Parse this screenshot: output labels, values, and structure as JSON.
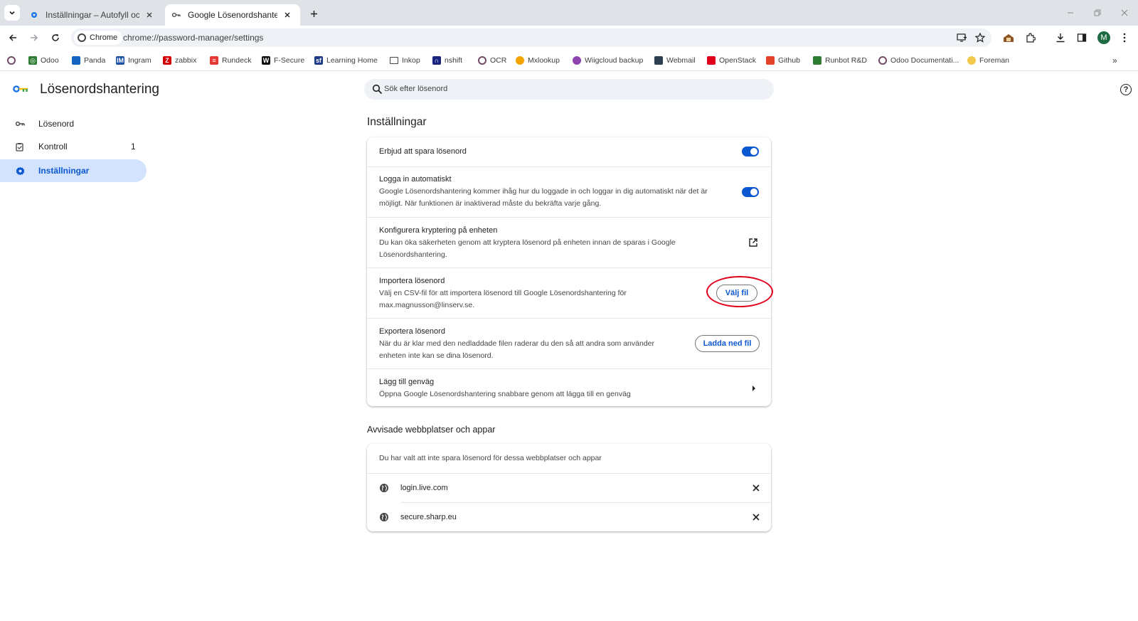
{
  "browser": {
    "tabs": [
      {
        "title": "Inställningar – Autofyll och lösenord",
        "icon": "gear-icon"
      },
      {
        "title": "Google Lösenordshantering",
        "icon": "key-icon"
      }
    ],
    "omnibox": {
      "chip_label": "Chrome",
      "url": "chrome://password-manager/settings"
    },
    "avatar_initial": "M"
  },
  "bookmarks": [
    {
      "label": "",
      "icon": "odoo-circle-icon",
      "color": "#714b67"
    },
    {
      "label": "Odoo",
      "icon": "odoo-icon",
      "color": "#2e7d32"
    },
    {
      "label": "Panda",
      "icon": "panda-icon",
      "color": "#1565c0"
    },
    {
      "label": "Ingram",
      "icon": "ingram-icon",
      "color": "#1a4fa3"
    },
    {
      "label": "zabbix",
      "icon": "zabbix-icon",
      "color": "#d40000"
    },
    {
      "label": "Rundeck",
      "icon": "rundeck-icon",
      "color": "#e53935"
    },
    {
      "label": "F-Secure",
      "icon": "fsecure-icon",
      "color": "#111111"
    },
    {
      "label": "Learning Home",
      "icon": "salesforce-icon",
      "color": "#1e3a8a"
    },
    {
      "label": "Inkop",
      "icon": "folder-icon",
      "color": "#444444"
    },
    {
      "label": "nshift",
      "icon": "nshift-icon",
      "color": "#1a237e"
    },
    {
      "label": "OCR",
      "icon": "ocr-icon",
      "color": "#714b67"
    },
    {
      "label": "Mxlookup",
      "icon": "mxlookup-icon",
      "color": "#f4a300"
    },
    {
      "label": "Wiigcloud backup",
      "icon": "wiigcloud-icon",
      "color": "#8e44ad"
    },
    {
      "label": "Webmail",
      "icon": "webmail-icon",
      "color": "#2c3e50"
    },
    {
      "label": "OpenStack",
      "icon": "openstack-icon",
      "color": "#e0001b"
    },
    {
      "label": "Github",
      "icon": "gitlab-icon",
      "color": "#e24329"
    },
    {
      "label": "Runbot R&D",
      "icon": "runbot-icon",
      "color": "#2e7d32"
    },
    {
      "label": "Odoo Documentati...",
      "icon": "odoo-circle-icon",
      "color": "#714b67"
    },
    {
      "label": "Foreman",
      "icon": "foreman-icon",
      "color": "#f2c94c"
    }
  ],
  "app": {
    "title": "Lösenordshantering"
  },
  "sidebar": {
    "items": [
      {
        "label": "Lösenord",
        "icon": "key-icon"
      },
      {
        "label": "Kontroll",
        "icon": "checkup-icon",
        "count": "1"
      },
      {
        "label": "Inställningar",
        "icon": "gear-icon",
        "active": true
      }
    ]
  },
  "search": {
    "placeholder": "Sök efter lösenord"
  },
  "settings": {
    "section_title": "Inställningar",
    "offer_save": {
      "title": "Erbjud att spara lösenord",
      "enabled": true
    },
    "auto_signin": {
      "title": "Logga in automatiskt",
      "description": "Google Lösenordshantering kommer ihåg hur du loggade in och loggar in dig automatiskt när det är möjligt. När funktionen är inaktiverad måste du bekräfta varje gång.",
      "enabled": true
    },
    "encryption": {
      "title": "Konfigurera kryptering på enheten",
      "description": "Du kan öka säkerheten genom att kryptera lösenord på enheten innan de sparas i Google Lösenordshantering."
    },
    "import": {
      "title": "Importera lösenord",
      "description": "Välj en CSV-fil för att importera lösenord till Google Lösenordshantering för max.magnusson@linserv.se.",
      "button": "Välj fil"
    },
    "export": {
      "title": "Exportera lösenord",
      "description": "När du är klar med den nedladdade filen raderar du den så att andra som använder enheten inte kan se dina lösenord.",
      "button": "Ladda ned fil"
    },
    "shortcut": {
      "title": "Lägg till genväg",
      "description": "Öppna Google Lösenordshantering snabbare genom att lägga till en genväg"
    }
  },
  "rejected": {
    "section_title": "Avvisade webbplatser och appar",
    "intro": "Du har valt att inte spara lösenord för dessa webbplatser och appar",
    "sites": [
      "login.live.com",
      "secure.sharp.eu"
    ]
  },
  "colors": {
    "accent": "#0b57d0",
    "highlight": "#e0001b",
    "active_nav_bg": "#d3e3fd"
  }
}
